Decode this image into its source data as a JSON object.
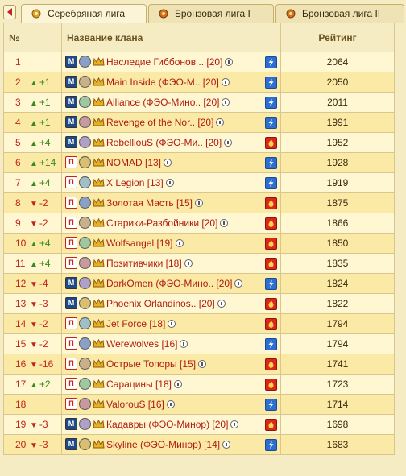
{
  "tabs": [
    {
      "label": "Серебряная лига",
      "active": true
    },
    {
      "label": "Бронзовая лига I",
      "active": false
    },
    {
      "label": "Бронзовая лига II",
      "active": false
    }
  ],
  "table": {
    "headers": {
      "rank": "№",
      "name": "Название клана",
      "rating": "Рейтинг"
    },
    "rows": [
      {
        "rank": "1",
        "delta": "",
        "dir": "",
        "badge": "М",
        "name": "Наследие Гиббонов .. [20]",
        "status": "lightning",
        "rating": "2064"
      },
      {
        "rank": "2",
        "delta": "+1",
        "dir": "up",
        "badge": "М",
        "name": "Main Inside (ФЭО-М.. [20]",
        "status": "lightning",
        "rating": "2050"
      },
      {
        "rank": "3",
        "delta": "+1",
        "dir": "up",
        "badge": "М",
        "name": "Alliance (ФЭО-Мино.. [20]",
        "status": "lightning",
        "rating": "2011"
      },
      {
        "rank": "4",
        "delta": "+1",
        "dir": "up",
        "badge": "М",
        "name": "Revenge of the Nor.. [20]",
        "status": "lightning",
        "rating": "1991"
      },
      {
        "rank": "5",
        "delta": "+4",
        "dir": "up",
        "badge": "М",
        "name": "RebellіouS (ФЭО-Ми.. [20]",
        "status": "fire",
        "rating": "1952"
      },
      {
        "rank": "6",
        "delta": "+14",
        "dir": "up",
        "badge": "П",
        "name": "NOMAD [13]",
        "status": "lightning",
        "rating": "1928"
      },
      {
        "rank": "7",
        "delta": "+4",
        "dir": "up",
        "badge": "П",
        "name": "X Legion [13]",
        "status": "lightning",
        "rating": "1919"
      },
      {
        "rank": "8",
        "delta": "-2",
        "dir": "down",
        "badge": "П",
        "name": "Золотая Масть [15]",
        "status": "fire",
        "rating": "1875"
      },
      {
        "rank": "9",
        "delta": "-2",
        "dir": "down",
        "badge": "П",
        "name": "Старики-Разбойники [20]",
        "status": "fire",
        "rating": "1866"
      },
      {
        "rank": "10",
        "delta": "+4",
        "dir": "up",
        "badge": "П",
        "name": "Wolfsangel [19]",
        "status": "fire",
        "rating": "1850"
      },
      {
        "rank": "11",
        "delta": "+4",
        "dir": "up",
        "badge": "П",
        "name": "Позитивчики [18]",
        "status": "fire",
        "rating": "1835"
      },
      {
        "rank": "12",
        "delta": "-4",
        "dir": "down",
        "badge": "М",
        "name": "DarkOmen (ФЭО-Мино.. [20]",
        "status": "lightning",
        "rating": "1824"
      },
      {
        "rank": "13",
        "delta": "-3",
        "dir": "down",
        "badge": "М",
        "name": "Phoenix Orlandinos.. [20]",
        "status": "fire",
        "rating": "1822"
      },
      {
        "rank": "14",
        "delta": "-2",
        "dir": "down",
        "badge": "П",
        "name": "Jet Force [18]",
        "status": "fire",
        "rating": "1794"
      },
      {
        "rank": "15",
        "delta": "-2",
        "dir": "down",
        "badge": "П",
        "name": "Werewolves [16]",
        "status": "lightning",
        "rating": "1794"
      },
      {
        "rank": "16",
        "delta": "-16",
        "dir": "down",
        "badge": "П",
        "name": "Острые Топоры [15]",
        "status": "fire",
        "rating": "1741"
      },
      {
        "rank": "17",
        "delta": "+2",
        "dir": "up",
        "badge": "П",
        "name": "Сарацины [18]",
        "status": "fire",
        "rating": "1723"
      },
      {
        "rank": "18",
        "delta": "",
        "dir": "",
        "badge": "П",
        "name": "ValorouS [16]",
        "status": "lightning",
        "rating": "1714"
      },
      {
        "rank": "19",
        "delta": "-3",
        "dir": "down",
        "badge": "М",
        "name": "Кадавры (ФЭО-Минор) [20]",
        "status": "fire",
        "rating": "1698"
      },
      {
        "rank": "20",
        "delta": "-3",
        "dir": "down",
        "badge": "М",
        "name": "Skyline (ФЭО-Минор) [14]",
        "status": "lightning",
        "rating": "1683"
      }
    ]
  }
}
